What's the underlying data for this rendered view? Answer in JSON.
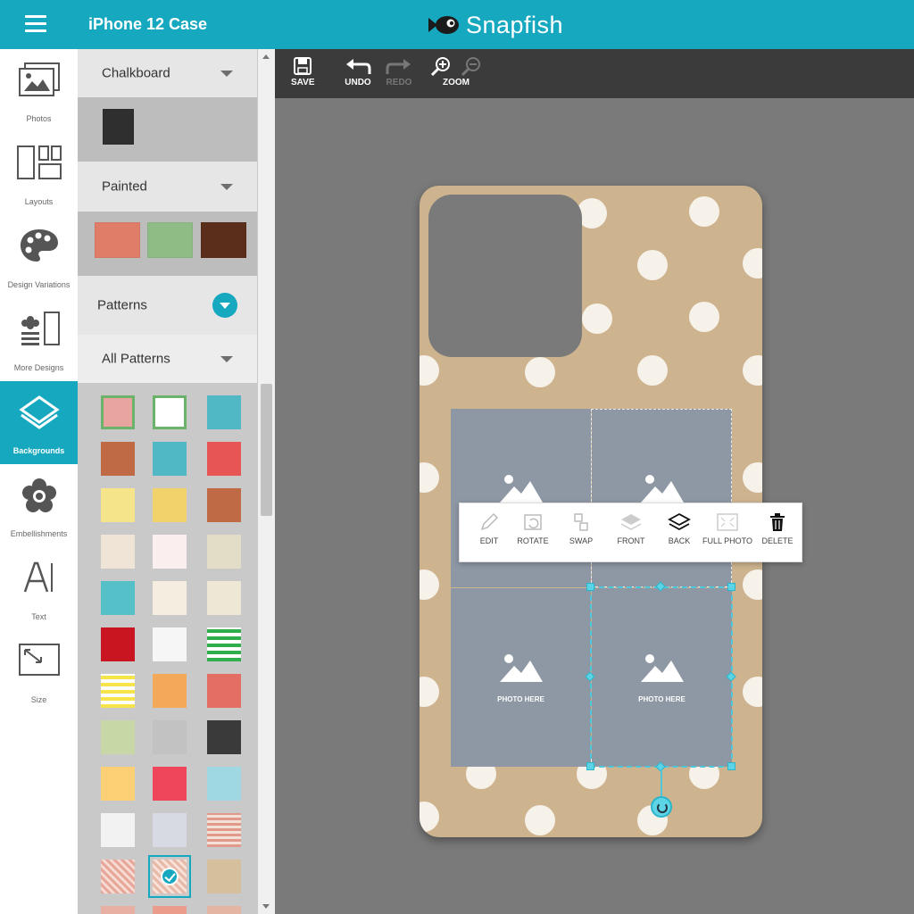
{
  "header": {
    "title": "iPhone 12 Case",
    "brand": "Snapfish"
  },
  "rail": {
    "items": [
      {
        "label": "Photos",
        "icon": "photos-icon"
      },
      {
        "label": "Layouts",
        "icon": "layouts-icon"
      },
      {
        "label": "Design Variations",
        "icon": "palette-icon"
      },
      {
        "label": "More Designs",
        "icon": "more-designs-icon"
      },
      {
        "label": "Backgrounds",
        "icon": "backgrounds-icon",
        "active": true
      },
      {
        "label": "Embellishments",
        "icon": "flower-icon"
      },
      {
        "label": "Text",
        "icon": "text-icon"
      },
      {
        "label": "Size",
        "icon": "size-icon"
      }
    ]
  },
  "panel": {
    "categories": [
      {
        "title": "Chalkboard"
      },
      {
        "title": "Painted"
      },
      {
        "title": "Patterns"
      },
      {
        "title": "All Patterns"
      }
    ]
  },
  "toolbar": {
    "save": "SAVE",
    "undo": "UNDO",
    "redo": "REDO",
    "zoom": "ZOOM"
  },
  "canvas": {
    "slots": [
      "PHOTO HERE",
      "PHOTO HERE"
    ]
  },
  "context_menu": {
    "edit": "EDIT",
    "rotate": "ROTATE",
    "swap": "SWAP",
    "front": "FRONT",
    "back": "BACK",
    "full_photo": "FULL PHOTO",
    "delete": "DELETE"
  },
  "colors": {
    "accent": "#16a8bf",
    "toolbar": "#3b3b3b",
    "canvas": "#7a7a7a",
    "case": "#cdb48f",
    "slot": "#8e97a4"
  }
}
